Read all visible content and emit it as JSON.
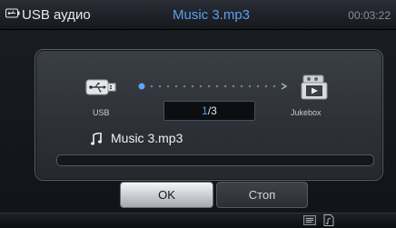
{
  "title_bar": {
    "source": "USB аудио",
    "track_title": "Music 3.mp3",
    "time": "00:03:22",
    "source_icon": "usb-device-icon"
  },
  "dialog": {
    "source_label": "USB",
    "target_label": "Jukebox",
    "source_icon": "usb-plug-icon",
    "target_icon": "jukebox-icon",
    "counter": {
      "current": "1",
      "separator": "/",
      "total": "3"
    },
    "file_icon": "music-note-icon",
    "file_name": "Music 3.mp3",
    "progress_fraction": 0.0,
    "buttons": {
      "ok_label": "OK",
      "stop_label": "Стоп"
    }
  },
  "bottom_bar": {
    "icons": [
      "rnd-icon",
      "music-file-icon"
    ]
  },
  "colors": {
    "accent": "#5a9ff2",
    "text": "#e6e9ee",
    "background": "#101317"
  }
}
